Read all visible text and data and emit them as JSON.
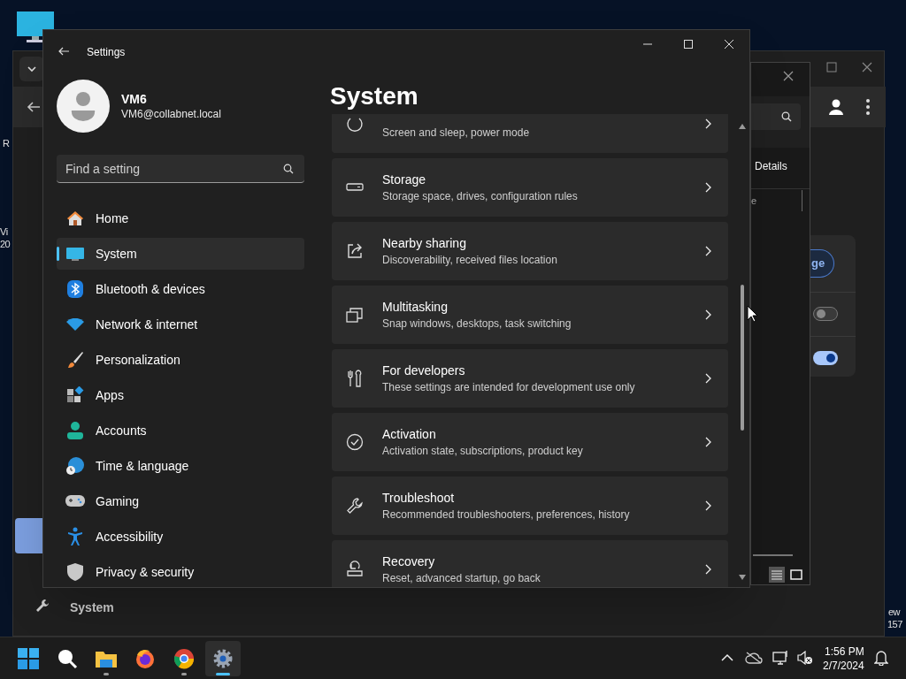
{
  "desktop": {
    "fragments": [
      "R",
      "Vi",
      "20",
      "ew",
      "157"
    ]
  },
  "background_browser": {
    "sidebar_item": "System",
    "button": "ge",
    "toggles": [
      {
        "on": false
      },
      {
        "on": true
      }
    ]
  },
  "background_explorer": {
    "tab": "Details",
    "column": "e"
  },
  "settings": {
    "title": "Settings",
    "user": {
      "name": "VM6",
      "email": "VM6@collabnet.local"
    },
    "search": {
      "placeholder": "Find a setting"
    },
    "nav": [
      {
        "label": "Home",
        "selected": false
      },
      {
        "label": "System",
        "selected": true
      },
      {
        "label": "Bluetooth & devices",
        "selected": false
      },
      {
        "label": "Network & internet",
        "selected": false
      },
      {
        "label": "Personalization",
        "selected": false
      },
      {
        "label": "Apps",
        "selected": false
      },
      {
        "label": "Accounts",
        "selected": false
      },
      {
        "label": "Time & language",
        "selected": false
      },
      {
        "label": "Gaming",
        "selected": false
      },
      {
        "label": "Accessibility",
        "selected": false
      },
      {
        "label": "Privacy & security",
        "selected": false
      }
    ],
    "heading": "System",
    "items": [
      {
        "subtitle": "Screen and sleep, power mode"
      },
      {
        "title": "Storage",
        "subtitle": "Storage space, drives, configuration rules"
      },
      {
        "title": "Nearby sharing",
        "subtitle": "Discoverability, received files location"
      },
      {
        "title": "Multitasking",
        "subtitle": "Snap windows, desktops, task switching"
      },
      {
        "title": "For developers",
        "subtitle": "These settings are intended for development use only"
      },
      {
        "title": "Activation",
        "subtitle": "Activation state, subscriptions, product key"
      },
      {
        "title": "Troubleshoot",
        "subtitle": "Recommended troubleshooters, preferences, history"
      },
      {
        "title": "Recovery",
        "subtitle": "Reset, advanced startup, go back"
      }
    ]
  },
  "taskbar": {
    "apps": [
      {
        "running": false,
        "selected": false
      },
      {
        "running": false,
        "selected": false
      },
      {
        "running": true,
        "selected": false
      },
      {
        "running": false,
        "selected": false
      },
      {
        "running": true,
        "selected": false
      },
      {
        "running": true,
        "selected": true
      }
    ],
    "clock": {
      "time": "1:56 PM",
      "date": "2/7/2024"
    }
  }
}
